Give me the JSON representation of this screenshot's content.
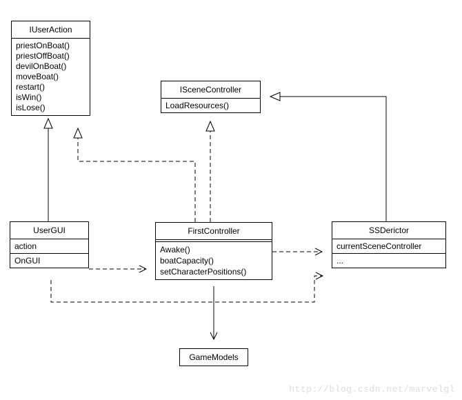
{
  "classes": {
    "iUserAction": {
      "name": "IUserAction",
      "methods": [
        "priestOnBoat()",
        "priestOffBoat()",
        "devilOnBoat()",
        "moveBoat()",
        "restart()",
        "isWin()",
        "isLose()"
      ]
    },
    "iSceneController": {
      "name": "ISceneController",
      "methods": [
        "LoadResources()"
      ]
    },
    "userGUI": {
      "name": "UserGUI",
      "attrs": [
        "action"
      ],
      "ops": [
        "OnGUI"
      ]
    },
    "firstController": {
      "name": "FirstController",
      "methods": [
        "Awake()",
        "boatCapacity()",
        "setCharacterPositions()"
      ]
    },
    "ssDerictor": {
      "name": "SSDerictor",
      "attrs": [
        "currentSceneController"
      ],
      "ops": [
        "..."
      ]
    },
    "gameModels": {
      "name": "GameModels"
    }
  },
  "watermark": "http://blog.csdn.net/marvelgl"
}
